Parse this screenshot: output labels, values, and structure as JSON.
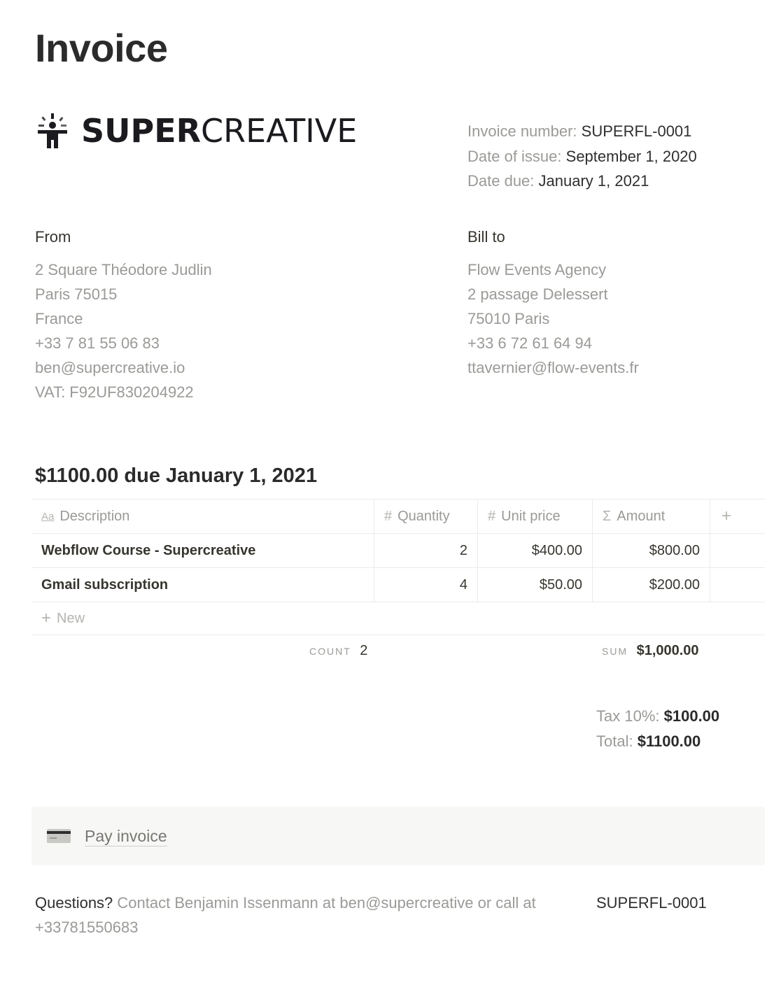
{
  "page": {
    "title": "Invoice"
  },
  "brand": {
    "name_bold": "SUPER",
    "name_light": "CREATIVE",
    "logo_icon": "person-burst-icon"
  },
  "meta": {
    "invoice_number_label": "Invoice number:",
    "invoice_number": "SUPERFL-0001",
    "date_of_issue_label": "Date of issue:",
    "date_of_issue": "September 1, 2020",
    "date_due_label": "Date due:",
    "date_due": "January 1, 2021"
  },
  "from": {
    "heading": "From",
    "lines": [
      "2 Square Théodore Judlin",
      "Paris 75015",
      "France",
      "+33 7 81 55 06 83",
      "ben@supercreative.io",
      "VAT: F92UF830204922"
    ]
  },
  "bill_to": {
    "heading": "Bill to",
    "lines": [
      "Flow Events Agency",
      "2 passage Delessert",
      "75010 Paris",
      "+33 6 72 61 64 94",
      "ttavernier@flow-events.fr"
    ]
  },
  "due_heading": "$1100.00 due January 1, 2021",
  "table": {
    "columns": [
      {
        "label": "Description",
        "icon": "Aa",
        "icon_name": "text-property-icon"
      },
      {
        "label": "Quantity",
        "icon": "#",
        "icon_name": "number-property-icon"
      },
      {
        "label": "Unit price",
        "icon": "#",
        "icon_name": "number-property-icon"
      },
      {
        "label": "Amount",
        "icon": "Σ",
        "icon_name": "formula-property-icon"
      }
    ],
    "add_column_icon": "+",
    "rows": [
      {
        "description": "Webflow Course - Supercreative",
        "quantity": "2",
        "unit_price": "$400.00",
        "amount": "$800.00"
      },
      {
        "description": "Gmail subscription",
        "quantity": "4",
        "unit_price": "$50.00",
        "amount": "$200.00"
      }
    ],
    "new_row_label": "New",
    "new_row_icon": "+",
    "count_label": "COUNT",
    "count_value": "2",
    "sum_label": "SUM",
    "sum_value": "$1,000.00"
  },
  "totals": {
    "tax_label": "Tax 10%:",
    "tax_value": "$100.00",
    "total_label": "Total:",
    "total_value": "$1100.00"
  },
  "pay": {
    "label": "Pay invoice",
    "icon": "credit-card-icon"
  },
  "footer": {
    "questions_label": "Questions?",
    "questions_text": "Contact Benjamin Issenmann at ben@supercreative or call at +33781550683",
    "reference": "SUPERFL-0001"
  }
}
